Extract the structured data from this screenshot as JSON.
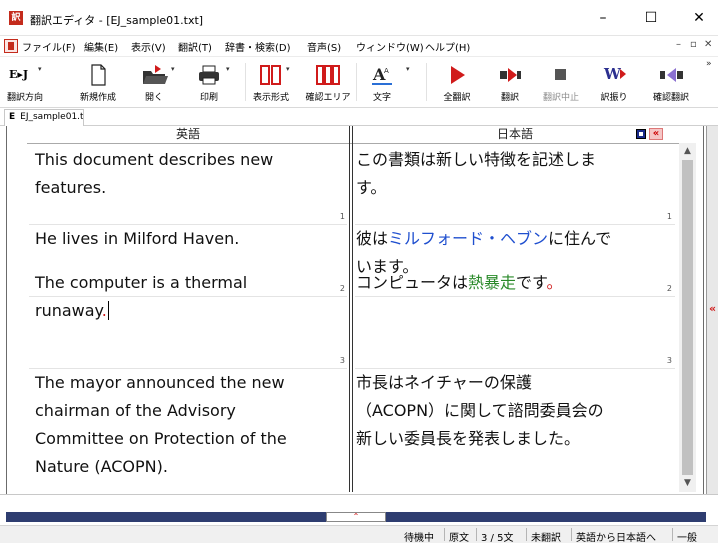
{
  "window": {
    "title": "翻訳エディタ - [EJ_sample01.txt]",
    "minimize": "–",
    "maximize": "☐",
    "close": "✕"
  },
  "menu": {
    "items": [
      "ファイル(F)",
      "編集(E)",
      "表示(V)",
      "翻訳(T)",
      "辞書・検索(D)",
      "音声(S)",
      "ウィンドウ(W)",
      "ヘルプ(H)"
    ],
    "mdi_min": "–",
    "mdi_restore": "▫",
    "mdi_close": "✕"
  },
  "toolbar": {
    "direction_icon_text": "E▸J",
    "buttons": [
      {
        "label": "翻訳方向",
        "icon": "direction-icon",
        "enabled": true
      },
      {
        "label": "新規作成",
        "icon": "new-document-icon",
        "enabled": true
      },
      {
        "label": "開く",
        "icon": "open-folder-icon",
        "enabled": true
      },
      {
        "label": "印刷",
        "icon": "printer-icon",
        "enabled": true
      },
      {
        "label": "表示形式",
        "icon": "view-format-icon",
        "enabled": true
      },
      {
        "label": "確認エリア",
        "icon": "confirm-area-icon",
        "enabled": true
      },
      {
        "label": "文字",
        "icon": "font-icon",
        "enabled": true
      },
      {
        "label": "全翻訳",
        "icon": "translate-all-icon",
        "enabled": true
      },
      {
        "label": "翻訳",
        "icon": "translate-icon",
        "enabled": true
      },
      {
        "label": "翻訳中止",
        "icon": "stop-icon",
        "enabled": false
      },
      {
        "label": "訳振り",
        "icon": "interlinear-icon",
        "enabled": true
      },
      {
        "label": "確認翻訳",
        "icon": "back-translate-icon",
        "enabled": true
      }
    ]
  },
  "document_tab": {
    "badge": "E",
    "name": "EJ_sample01.t"
  },
  "editor": {
    "source_header": "英語",
    "target_header": "日本語",
    "rows": [
      {
        "number": "1",
        "source_lines": [
          "This document describes new",
          "features."
        ],
        "target_lines": [
          "この書類は新しい特徴を記述しま",
          "す。"
        ]
      },
      {
        "number": "2",
        "source_lines": [
          "He lives in Milford Haven."
        ],
        "target_pre": "彼は",
        "target_highlight": "ミルフォード・ヘブン",
        "target_post": "に住んで",
        "target_line2": "います。"
      },
      {
        "number": "3",
        "source_line1": "The computer is a thermal",
        "source_line2": "runaway",
        "source_period": ".",
        "target_pre": "コンピュータは",
        "target_highlight": "熱暴走",
        "target_post": "です",
        "target_period": "。"
      },
      {
        "number": "",
        "source_lines": [
          "The mayor announced the new",
          "chairman of the Advisory",
          "Committee on Protection of the",
          "Nature (ACOPN)."
        ],
        "target_lines": [
          "市長はネイチャーの保護",
          "（ACOPN）に関して諮問委員会の",
          "新しい委員長を発表しました。"
        ]
      }
    ]
  },
  "colors": {
    "unknown_word": "#1f4fcf",
    "dictionary_word": "#2a8a2a",
    "marker": "#d01b1b",
    "splitter": "#2e3d70"
  },
  "status": {
    "state": "待機中",
    "mode": "原文",
    "progress": "3 / 5文",
    "translation_state": "未翻訳",
    "direction": "英語から日本語へ",
    "field": "一般"
  }
}
